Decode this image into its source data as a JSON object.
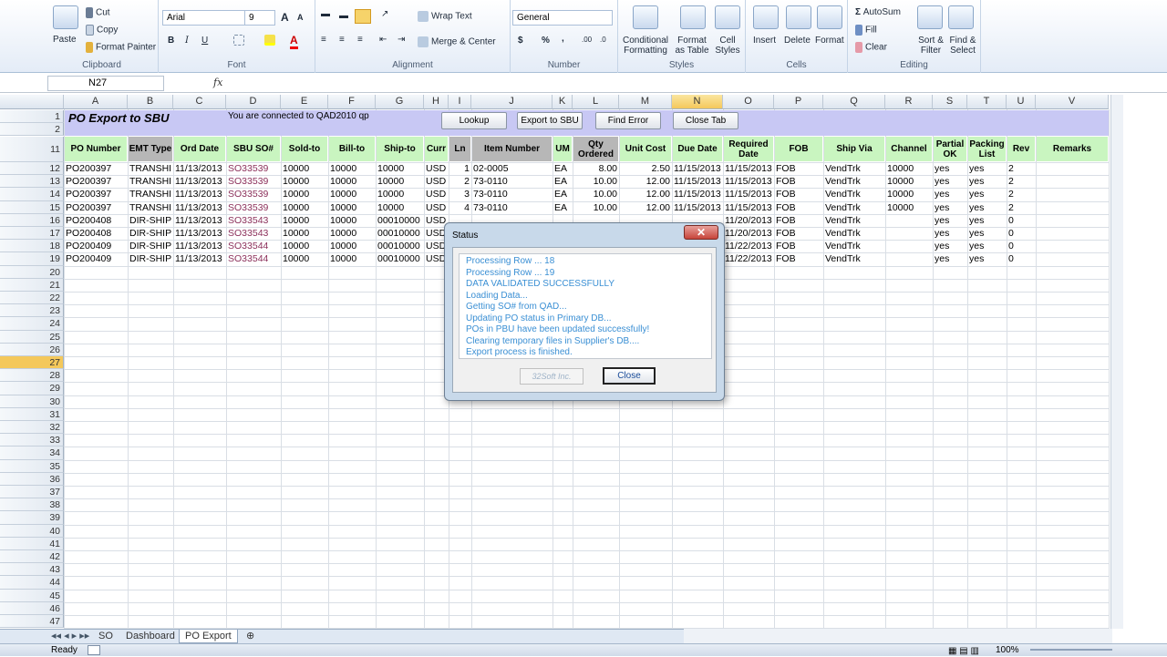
{
  "ribbon": {
    "clipboard": {
      "paste": "Paste",
      "cut": "Cut",
      "copy": "Copy",
      "format_painter": "Format Painter",
      "label": "Clipboard"
    },
    "font": {
      "name": "Arial",
      "size": "9",
      "label": "Font",
      "bold": "B",
      "italic": "I",
      "underline": "U",
      "grow": "A",
      "shrink": "A"
    },
    "alignment": {
      "wrap": "Wrap Text",
      "merge": "Merge & Center",
      "label": "Alignment"
    },
    "number": {
      "format": "General",
      "currency": "$",
      "percent": "%",
      "comma": ",",
      "label": "Number"
    },
    "styles": {
      "conditional": "Conditional",
      "conditional2": "Formatting",
      "format_table": "Format",
      "format_table2": "as Table",
      "cell_styles": "Cell",
      "cell_styles2": "Styles",
      "label": "Styles"
    },
    "cells": {
      "insert": "Insert",
      "delete": "Delete",
      "format": "Format",
      "label": "Cells"
    },
    "editing": {
      "autosum": "AutoSum",
      "fill": "Fill",
      "clear": "Clear",
      "sort": "Sort &",
      "sort2": "Filter",
      "find": "Find &",
      "find2": "Select",
      "label": "Editing"
    }
  },
  "formula_bar": {
    "name_box": "N27",
    "fx": "fx"
  },
  "columns": [
    "A",
    "B",
    "C",
    "D",
    "E",
    "F",
    "G",
    "H",
    "I",
    "J",
    "K",
    "L",
    "M",
    "N",
    "O",
    "P",
    "Q",
    "R",
    "S",
    "T",
    "U",
    "V"
  ],
  "row_numbers": [
    "1",
    "2",
    "11",
    "12",
    "13",
    "14",
    "15",
    "16",
    "17",
    "18",
    "19",
    "20",
    "21",
    "22",
    "23",
    "24",
    "25",
    "26",
    "27",
    "28",
    "29",
    "30",
    "31",
    "32",
    "33",
    "34",
    "35",
    "36",
    "37",
    "38",
    "39",
    "40",
    "41",
    "42",
    "43",
    "44",
    "45",
    "46",
    "47"
  ],
  "sheet": {
    "title": "PO Export to SBU",
    "connection": "You are connected to QAD2010 qp",
    "buttons": [
      "Lookup",
      "Export to SBU",
      "Find Error",
      "Close Tab"
    ],
    "headers": [
      "PO Number",
      "EMT Type",
      "Ord Date",
      "SBU SO#",
      "Sold-to",
      "Bill-to",
      "Ship-to",
      "Curr",
      "Ln",
      "Item Number",
      "UM",
      "Qty Ordered",
      "Unit Cost",
      "Due Date",
      "Required Date",
      "FOB",
      "Ship Via",
      "Channel",
      "Partial OK",
      "Packing List",
      "Rev",
      "Remarks"
    ],
    "rows": [
      [
        "PO200397",
        "TRANSHIF",
        "11/13/2013",
        "SO33539",
        "10000",
        "10000",
        "10000",
        "USD",
        "1",
        "02-0005",
        "EA",
        "8.00",
        "2.50",
        "11/15/2013",
        "11/15/2013",
        "FOB",
        "VendTrk",
        "10000",
        "yes",
        "yes",
        "2",
        ""
      ],
      [
        "PO200397",
        "TRANSHIF",
        "11/13/2013",
        "SO33539",
        "10000",
        "10000",
        "10000",
        "USD",
        "2",
        "73-0110",
        "EA",
        "10.00",
        "12.00",
        "11/15/2013",
        "11/15/2013",
        "FOB",
        "VendTrk",
        "10000",
        "yes",
        "yes",
        "2",
        ""
      ],
      [
        "PO200397",
        "TRANSHIF",
        "11/13/2013",
        "SO33539",
        "10000",
        "10000",
        "10000",
        "USD",
        "3",
        "73-0110",
        "EA",
        "10.00",
        "12.00",
        "11/15/2013",
        "11/15/2013",
        "FOB",
        "VendTrk",
        "10000",
        "yes",
        "yes",
        "2",
        ""
      ],
      [
        "PO200397",
        "TRANSHIF",
        "11/13/2013",
        "SO33539",
        "10000",
        "10000",
        "10000",
        "USD",
        "4",
        "73-0110",
        "EA",
        "10.00",
        "12.00",
        "11/15/2013",
        "11/15/2013",
        "FOB",
        "VendTrk",
        "10000",
        "yes",
        "yes",
        "2",
        ""
      ],
      [
        "PO200408",
        "DIR-SHIP",
        "11/13/2013",
        "SO33543",
        "10000",
        "10000",
        "00010000",
        "USD",
        "",
        "",
        "",
        "",
        "",
        "",
        "11/20/2013",
        "FOB",
        "VendTrk",
        "",
        "yes",
        "yes",
        "0",
        ""
      ],
      [
        "PO200408",
        "DIR-SHIP",
        "11/13/2013",
        "SO33543",
        "10000",
        "10000",
        "00010000",
        "USD",
        "",
        "",
        "",
        "",
        "",
        "",
        "11/20/2013",
        "FOB",
        "VendTrk",
        "",
        "yes",
        "yes",
        "0",
        ""
      ],
      [
        "PO200409",
        "DIR-SHIP",
        "11/13/2013",
        "SO33544",
        "10000",
        "10000",
        "00010000",
        "USD",
        "",
        "",
        "",
        "",
        "",
        "",
        "11/22/2013",
        "FOB",
        "VendTrk",
        "",
        "yes",
        "yes",
        "0",
        ""
      ],
      [
        "PO200409",
        "DIR-SHIP",
        "11/13/2013",
        "SO33544",
        "10000",
        "10000",
        "00010000",
        "USD",
        "",
        "",
        "",
        "",
        "",
        "",
        "11/22/2013",
        "FOB",
        "VendTrk",
        "",
        "yes",
        "yes",
        "0",
        ""
      ]
    ]
  },
  "dialog": {
    "title": "Status",
    "close_x": "✕",
    "messages": [
      "Processing Row ... 18",
      "Processing Row ... 19",
      "DATA VALIDATED SUCCESSFULLY",
      "Loading Data...",
      "Getting SO# from QAD...",
      "Updating PO status in Primary DB...",
      "POs in PBU have been updated successfully!",
      "Clearing temporary files in Supplier's DB....",
      "Export process is finished."
    ],
    "brand": "32Soft Inc.",
    "close_label": "Close"
  },
  "tabs": [
    "SO",
    "Dashboard",
    "PO Export"
  ],
  "status": {
    "ready": "Ready",
    "zoom": "100%"
  }
}
